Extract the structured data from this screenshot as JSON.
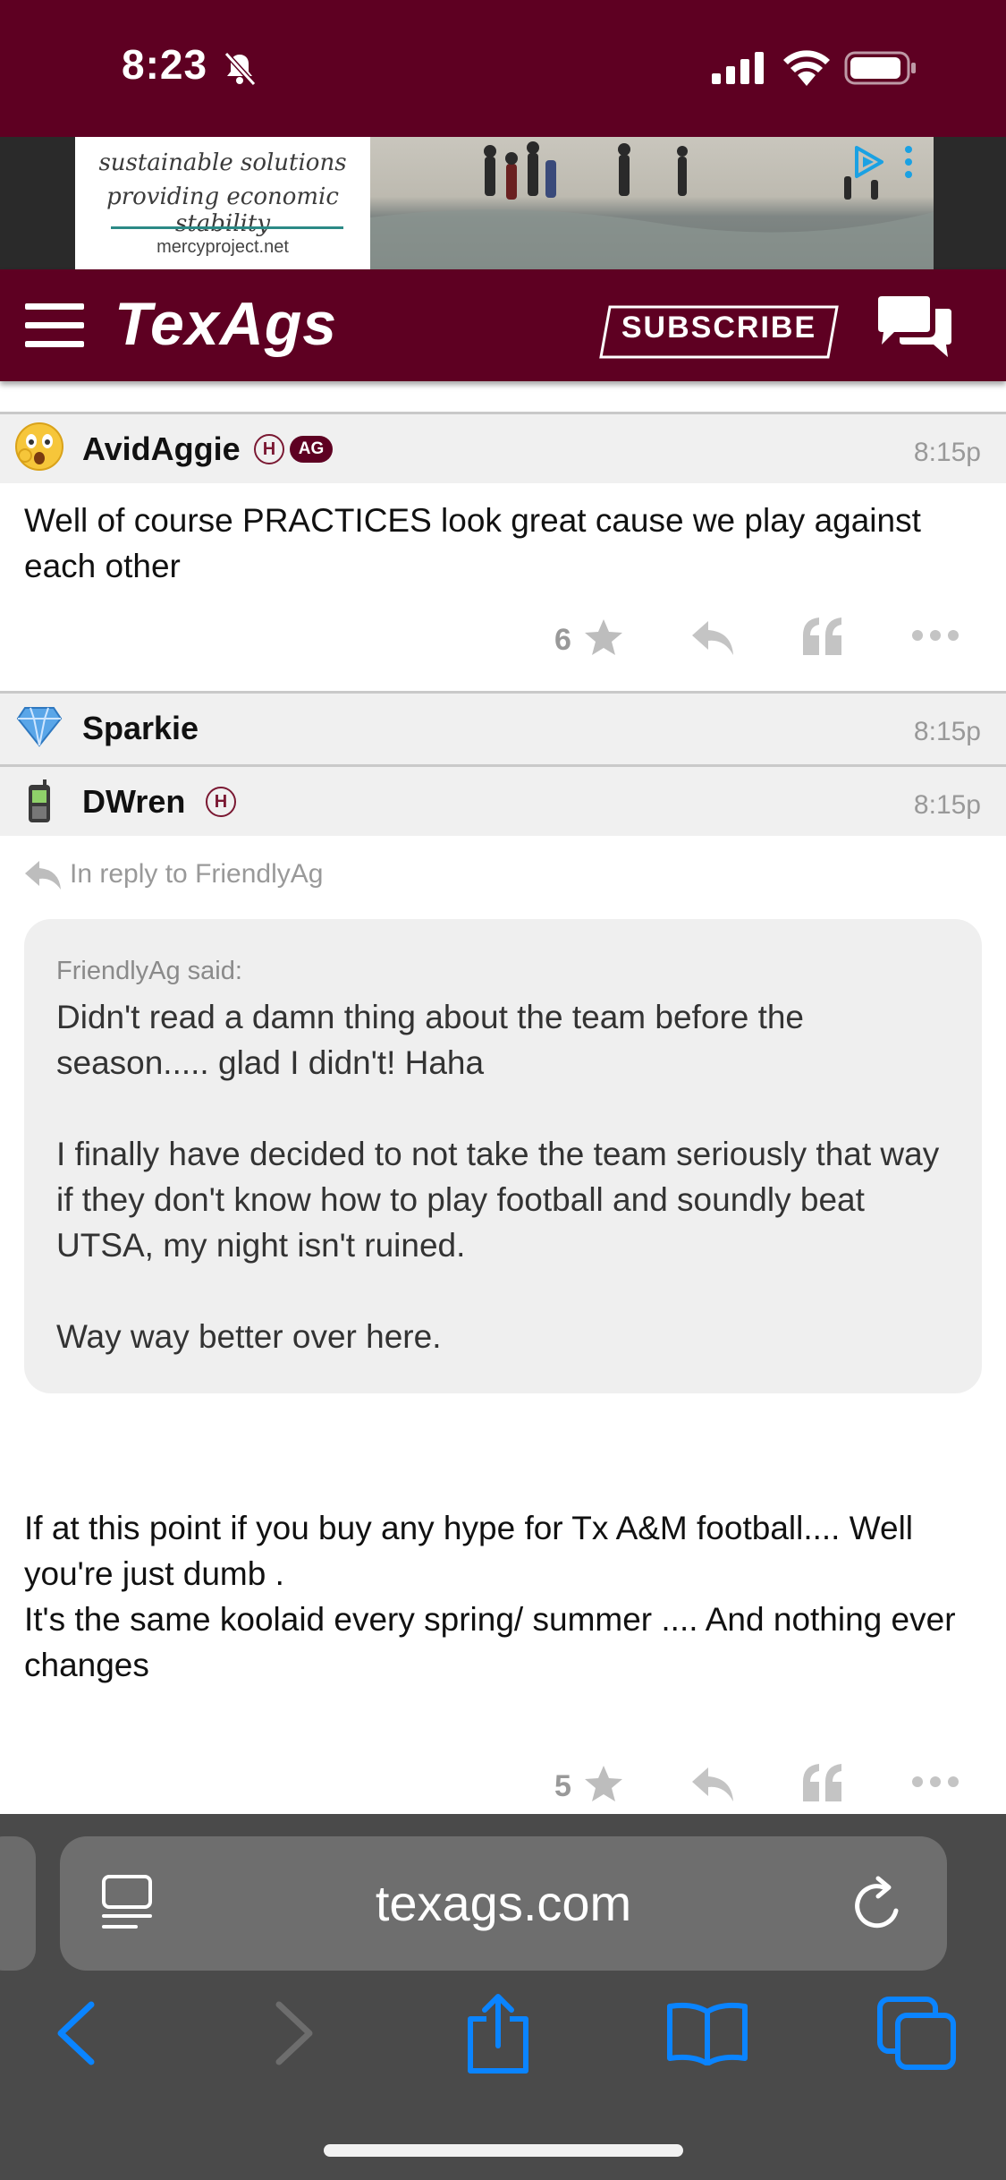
{
  "status_bar": {
    "time": "8:23"
  },
  "ad": {
    "tagline_1": "sustainable solutions",
    "tagline_2": "providing economic stability",
    "url": "mercyproject.net"
  },
  "header": {
    "logo": "TexAgs",
    "subscribe_label": "SUBSCRIBE"
  },
  "posts": [
    {
      "username": "AvidAggie",
      "badges": [
        "H",
        "AG"
      ],
      "time": "8:15p",
      "body": "Well of course PRACTICES look great cause we play against each other",
      "stars": "6"
    },
    {
      "username": "Sparkie",
      "time": "8:15p"
    },
    {
      "username": "DWren",
      "badges": [
        "H"
      ],
      "time": "8:15p",
      "reply_to": "In reply to FriendlyAg",
      "quote_author": "FriendlyAg said:",
      "quote_text": "Didn't read a damn thing about the team before the season..... glad I didn't! Haha\n\nI finally have decided to not take the team seriously that way if they don't know how to play football and soundly beat UTSA, my night isn't ruined.\n\nWay way better over here.",
      "body_1": "If at this point if you buy any hype for Tx A&M football.... Well you're just dumb .",
      "body_2": "It's the same koolaid every spring/ summer .... And nothing ever changes",
      "stars": "5"
    }
  ],
  "browser": {
    "url": "texags.com"
  },
  "colors": {
    "maroon": "#5e0022",
    "ios_blue": "#0a84ff"
  }
}
